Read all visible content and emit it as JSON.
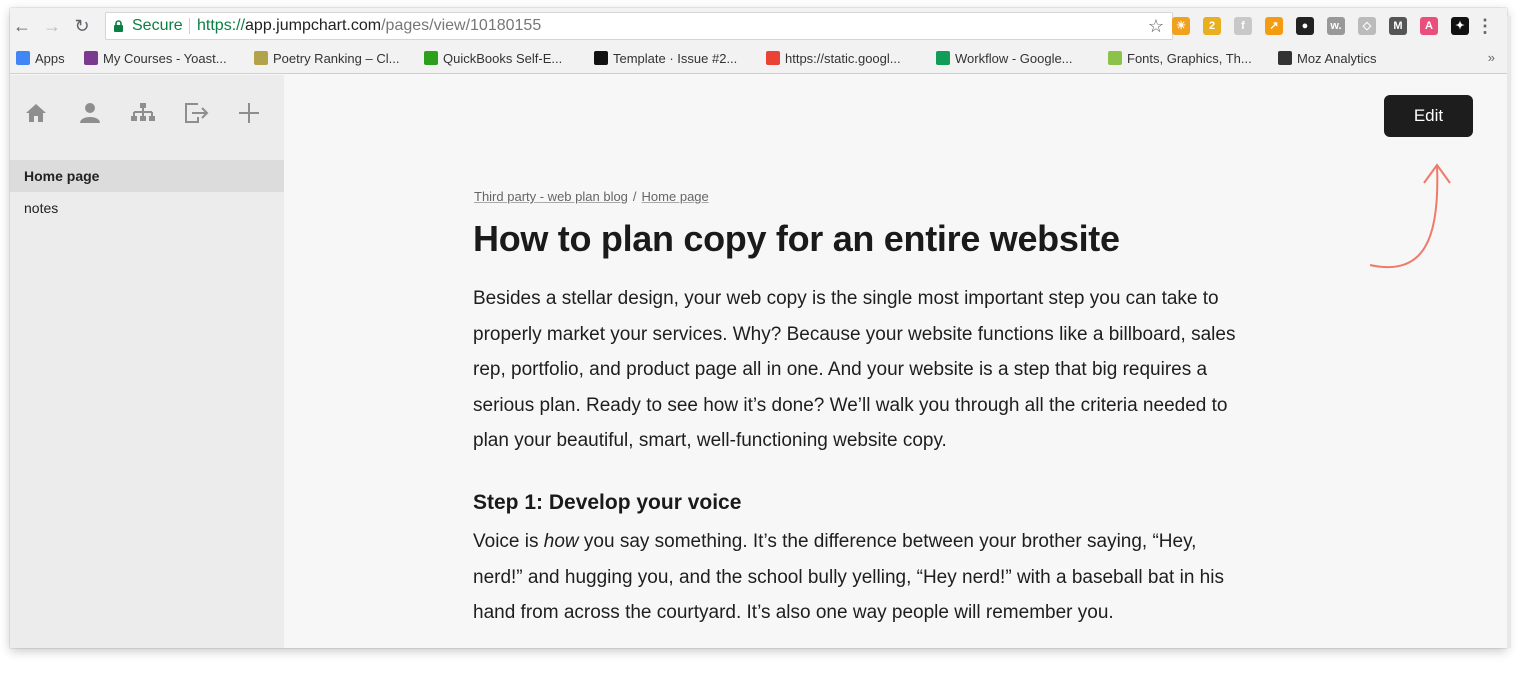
{
  "browser": {
    "secure_label": "Secure",
    "url_scheme": "https://",
    "url_host": "app.jumpchart.com",
    "url_path": "/pages/view/10180155",
    "bookmarks": [
      {
        "label": "Apps",
        "color": "#4285f4"
      },
      {
        "label": "My Courses - Yoast...",
        "color": "#7a3b8f"
      },
      {
        "label": "Poetry Ranking – Cl...",
        "color": "#b2a24a"
      },
      {
        "label": "QuickBooks Self-E...",
        "color": "#2ca01c"
      },
      {
        "label": "Template · Issue #2...",
        "color": "#111111"
      },
      {
        "label": "https://static.googl...",
        "color": "#ea4335"
      },
      {
        "label": "Workflow - Google...",
        "color": "#0f9d58"
      },
      {
        "label": "Fonts, Graphics, Th...",
        "color": "#8bc34a"
      },
      {
        "label": "Moz Analytics",
        "color": "#333333"
      }
    ],
    "bookmarks_more": "»",
    "extensions": [
      {
        "name": "sun-extension-icon",
        "color": "#f0a21f",
        "glyph": "☀"
      },
      {
        "name": "lightbulb-extension-icon",
        "color": "#e8b020",
        "glyph": "2"
      },
      {
        "name": "grey-extension-icon",
        "color": "#c8c8c8",
        "glyph": "f"
      },
      {
        "name": "chart-extension-icon",
        "color": "#f39c12",
        "glyph": "↗"
      },
      {
        "name": "camera-extension-icon",
        "color": "#222222",
        "glyph": "●"
      },
      {
        "name": "w-extension-icon",
        "color": "#999999",
        "glyph": "w."
      },
      {
        "name": "shield-extension-icon",
        "color": "#bbbbbb",
        "glyph": "◇"
      },
      {
        "name": "m-extension-icon",
        "color": "#555555",
        "glyph": "M"
      },
      {
        "name": "a-extension-icon",
        "color": "#e94f7c",
        "glyph": "A"
      },
      {
        "name": "puzzle-extension-icon",
        "color": "#111111",
        "glyph": "✦"
      }
    ]
  },
  "sidebar": {
    "icons": [
      "home-icon",
      "user-icon",
      "sitemap-icon",
      "export-icon",
      "add-icon"
    ],
    "items": [
      {
        "label": "Home page",
        "active": true
      },
      {
        "label": "notes",
        "active": false
      }
    ]
  },
  "main": {
    "edit_label": "Edit",
    "breadcrumb": {
      "parent": "Third party - web plan blog",
      "separator": "/",
      "current": "Home page"
    },
    "title": "How to plan copy for an entire website",
    "paragraph1": [
      "Besides a stellar design, your web copy is the single most important step you can take to",
      "properly market your services. Why? Because your website functions like a billboard, sales",
      "rep, portfolio, and product page all in one. And your website is a step that big requires a",
      "serious plan. Ready to see how it’s done? We’ll walk you through all the criteria needed to",
      "plan your beautiful, smart, well-functioning website copy."
    ],
    "step1_heading": "Step 1: Develop your voice",
    "paragraph2": {
      "line1_before": "Voice is ",
      "line1_em": "how",
      "line1_after": " you say something. It’s the difference between your brother saying, “Hey,",
      "line2": "nerd!” and hugging you, and the school bully yelling, “Hey nerd!” with a baseball bat in his",
      "line3": "hand from across the courtyard. It’s also one way people will remember you."
    },
    "annotation_color": "#f07a6a"
  }
}
